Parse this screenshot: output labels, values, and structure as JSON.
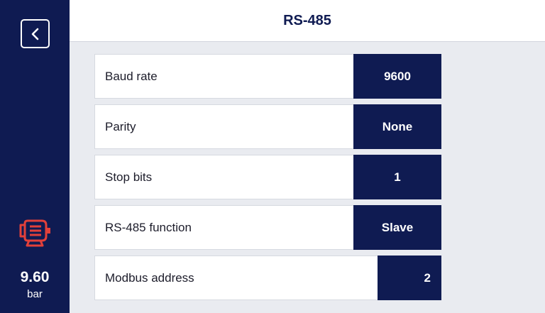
{
  "header": {
    "title": "RS-485"
  },
  "sidebar": {
    "back_icon": "chevron-left-icon",
    "motor_icon": "motor-icon",
    "motor_icon_color": "#e2403a",
    "pressure_value": "9.60",
    "pressure_unit": "bar"
  },
  "settings": [
    {
      "label": "Baud rate",
      "value": "9600"
    },
    {
      "label": "Parity",
      "value": "None"
    },
    {
      "label": "Stop bits",
      "value": "1"
    },
    {
      "label": "RS-485 function",
      "value": "Slave"
    },
    {
      "label": "Modbus address",
      "value": "2"
    }
  ],
  "colors": {
    "primary": "#0f1b52",
    "background": "#e9ebf0",
    "alert": "#e2403a"
  }
}
